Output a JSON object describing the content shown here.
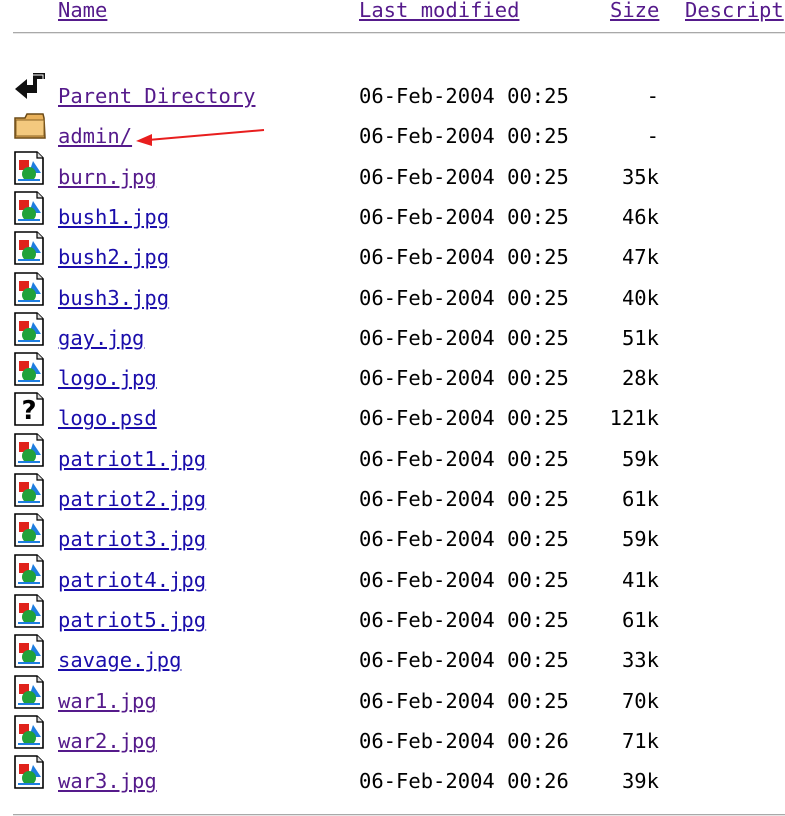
{
  "header": {
    "name": "Name",
    "last_modified": "Last modified",
    "size": "Size",
    "description": "Descript"
  },
  "rows": [
    {
      "icon": "parent-directory-icon",
      "name": "Parent Directory",
      "modified": "06-Feb-2004 00:25",
      "size": "-",
      "visited": true
    },
    {
      "icon": "folder-icon",
      "name": "admin/",
      "modified": "06-Feb-2004 00:25",
      "size": "-",
      "visited": true
    },
    {
      "icon": "image-file-icon",
      "name": "burn.jpg",
      "modified": "06-Feb-2004 00:25",
      "size": "35k",
      "visited": true
    },
    {
      "icon": "image-file-icon",
      "name": "bush1.jpg",
      "modified": "06-Feb-2004 00:25",
      "size": "46k",
      "visited": false
    },
    {
      "icon": "image-file-icon",
      "name": "bush2.jpg",
      "modified": "06-Feb-2004 00:25",
      "size": "47k",
      "visited": false
    },
    {
      "icon": "image-file-icon",
      "name": "bush3.jpg",
      "modified": "06-Feb-2004 00:25",
      "size": "40k",
      "visited": false
    },
    {
      "icon": "image-file-icon",
      "name": "gay.jpg",
      "modified": "06-Feb-2004 00:25",
      "size": "51k",
      "visited": false
    },
    {
      "icon": "image-file-icon",
      "name": "logo.jpg",
      "modified": "06-Feb-2004 00:25",
      "size": "28k",
      "visited": false
    },
    {
      "icon": "unknown-file-icon",
      "name": "logo.psd",
      "modified": "06-Feb-2004 00:25",
      "size": "121k",
      "visited": false
    },
    {
      "icon": "image-file-icon",
      "name": "patriot1.jpg",
      "modified": "06-Feb-2004 00:25",
      "size": "59k",
      "visited": false
    },
    {
      "icon": "image-file-icon",
      "name": "patriot2.jpg",
      "modified": "06-Feb-2004 00:25",
      "size": "61k",
      "visited": false
    },
    {
      "icon": "image-file-icon",
      "name": "patriot3.jpg",
      "modified": "06-Feb-2004 00:25",
      "size": "59k",
      "visited": false
    },
    {
      "icon": "image-file-icon",
      "name": "patriot4.jpg",
      "modified": "06-Feb-2004 00:25",
      "size": "41k",
      "visited": false
    },
    {
      "icon": "image-file-icon",
      "name": "patriot5.jpg",
      "modified": "06-Feb-2004 00:25",
      "size": "61k",
      "visited": false
    },
    {
      "icon": "image-file-icon",
      "name": "savage.jpg",
      "modified": "06-Feb-2004 00:25",
      "size": "33k",
      "visited": false
    },
    {
      "icon": "image-file-icon",
      "name": "war1.jpg",
      "modified": "06-Feb-2004 00:25",
      "size": "70k",
      "visited": true
    },
    {
      "icon": "image-file-icon",
      "name": "war2.jpg",
      "modified": "06-Feb-2004 00:26",
      "size": "71k",
      "visited": true
    },
    {
      "icon": "image-file-icon",
      "name": "war3.jpg",
      "modified": "06-Feb-2004 00:26",
      "size": "39k",
      "visited": true
    }
  ],
  "annotation": {
    "arrow_color": "#e81e1e",
    "arrow_points_to": "admin/"
  },
  "colors": {
    "link": "#1a0dab",
    "visited": "#551a8b",
    "rule": "#a9a9a9"
  }
}
